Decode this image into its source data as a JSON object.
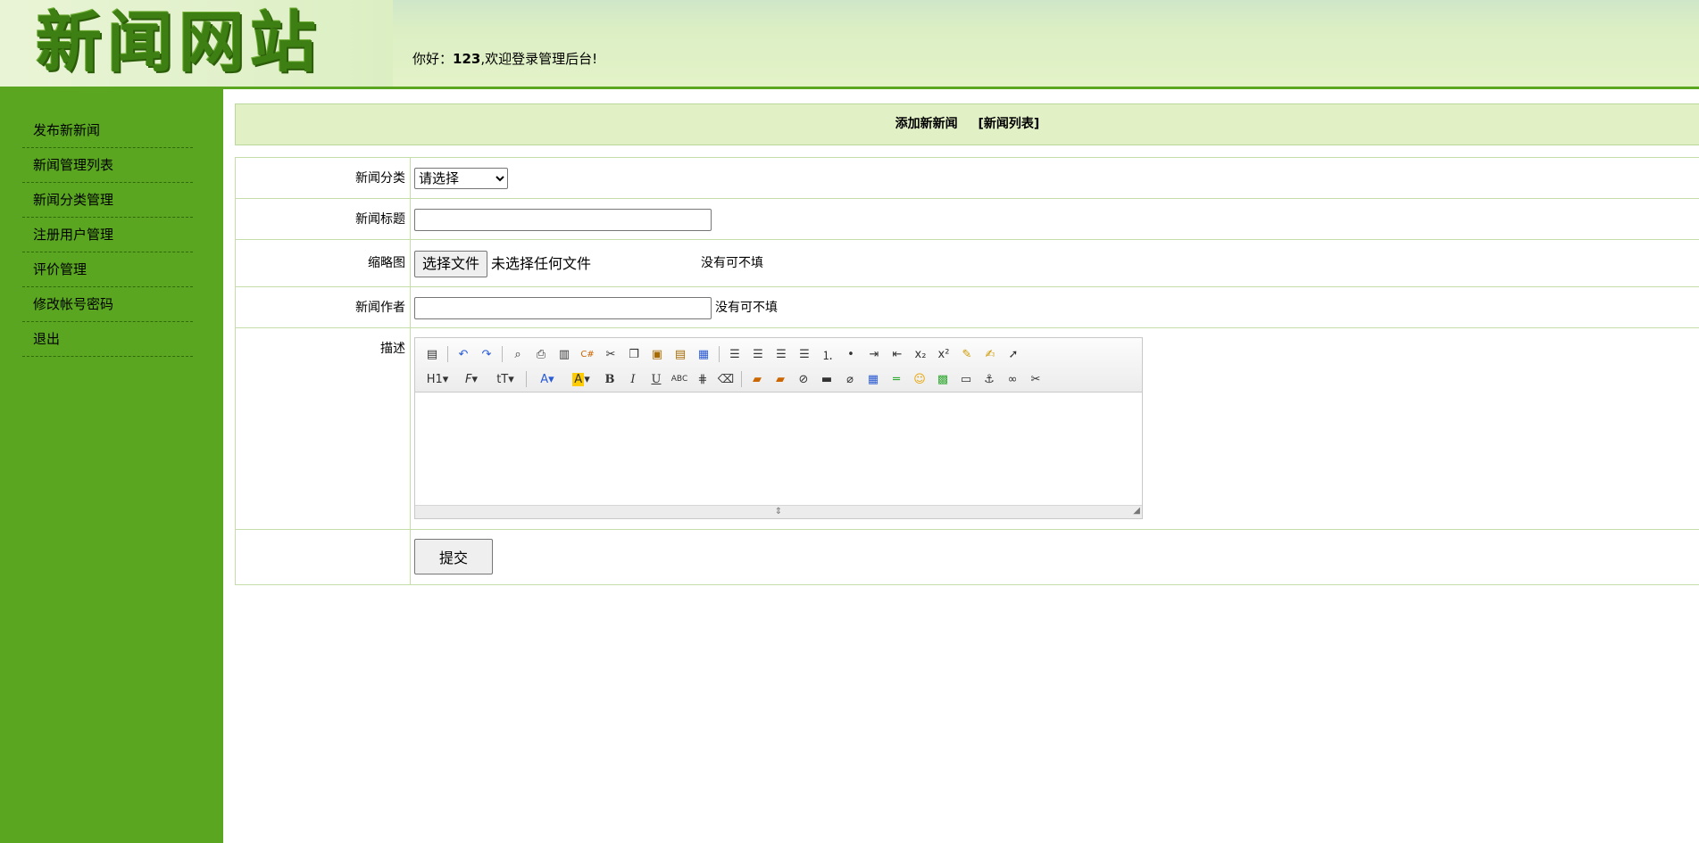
{
  "header": {
    "logo_text": "新闻网站",
    "greeting_prefix": "你好：",
    "username": "123",
    "greeting_suffix": ",欢迎登录管理后台!"
  },
  "sidebar": {
    "items": [
      {
        "label": "发布新新闻"
      },
      {
        "label": "新闻管理列表"
      },
      {
        "label": "新闻分类管理"
      },
      {
        "label": "注册用户管理"
      },
      {
        "label": "评价管理"
      },
      {
        "label": "修改帐号密码"
      },
      {
        "label": "退出"
      }
    ]
  },
  "title_bar": {
    "current": "添加新新闻",
    "link": "[新闻列表]"
  },
  "form": {
    "category": {
      "label": "新闻分类",
      "selected": "请选择"
    },
    "title": {
      "label": "新闻标题",
      "value": ""
    },
    "thumbnail": {
      "label": "缩略图",
      "button": "选择文件",
      "status": "未选择任何文件",
      "hint": "没有可不填"
    },
    "author": {
      "label": "新闻作者",
      "value": "",
      "hint": "没有可不填"
    },
    "description": {
      "label": "描述"
    },
    "submit_label": "提交"
  },
  "editor": {
    "toolbar_row1": [
      "source-icon",
      "undo-icon",
      "redo-icon",
      "preview-icon",
      "print-icon",
      "template-icon",
      "code-icon",
      "cut-icon",
      "copy-icon",
      "paste-icon",
      "paste-plain-icon",
      "paste-word-icon",
      "align-left-icon",
      "align-center-icon",
      "align-right-icon",
      "align-justify-icon",
      "ordered-list-icon",
      "unordered-list-icon",
      "indent-icon",
      "outdent-icon",
      "subscript-icon",
      "superscript-icon",
      "clear-format-icon",
      "select-all-icon",
      "cursor-icon"
    ],
    "toolbar_row2": [
      "heading-icon",
      "font-family-icon",
      "font-size-icon",
      "font-color-icon",
      "highlight-icon",
      "bold-icon",
      "italic-icon",
      "underline-icon",
      "strikethrough-icon",
      "line-height-icon",
      "eraser-icon",
      "image-icon",
      "multi-image-icon",
      "flash-icon",
      "media-icon",
      "attachment-icon",
      "table-icon",
      "hr-icon",
      "emoticon-icon",
      "map-icon",
      "pagebreak-icon",
      "anchor-icon",
      "link-icon",
      "unlink-icon"
    ]
  }
}
